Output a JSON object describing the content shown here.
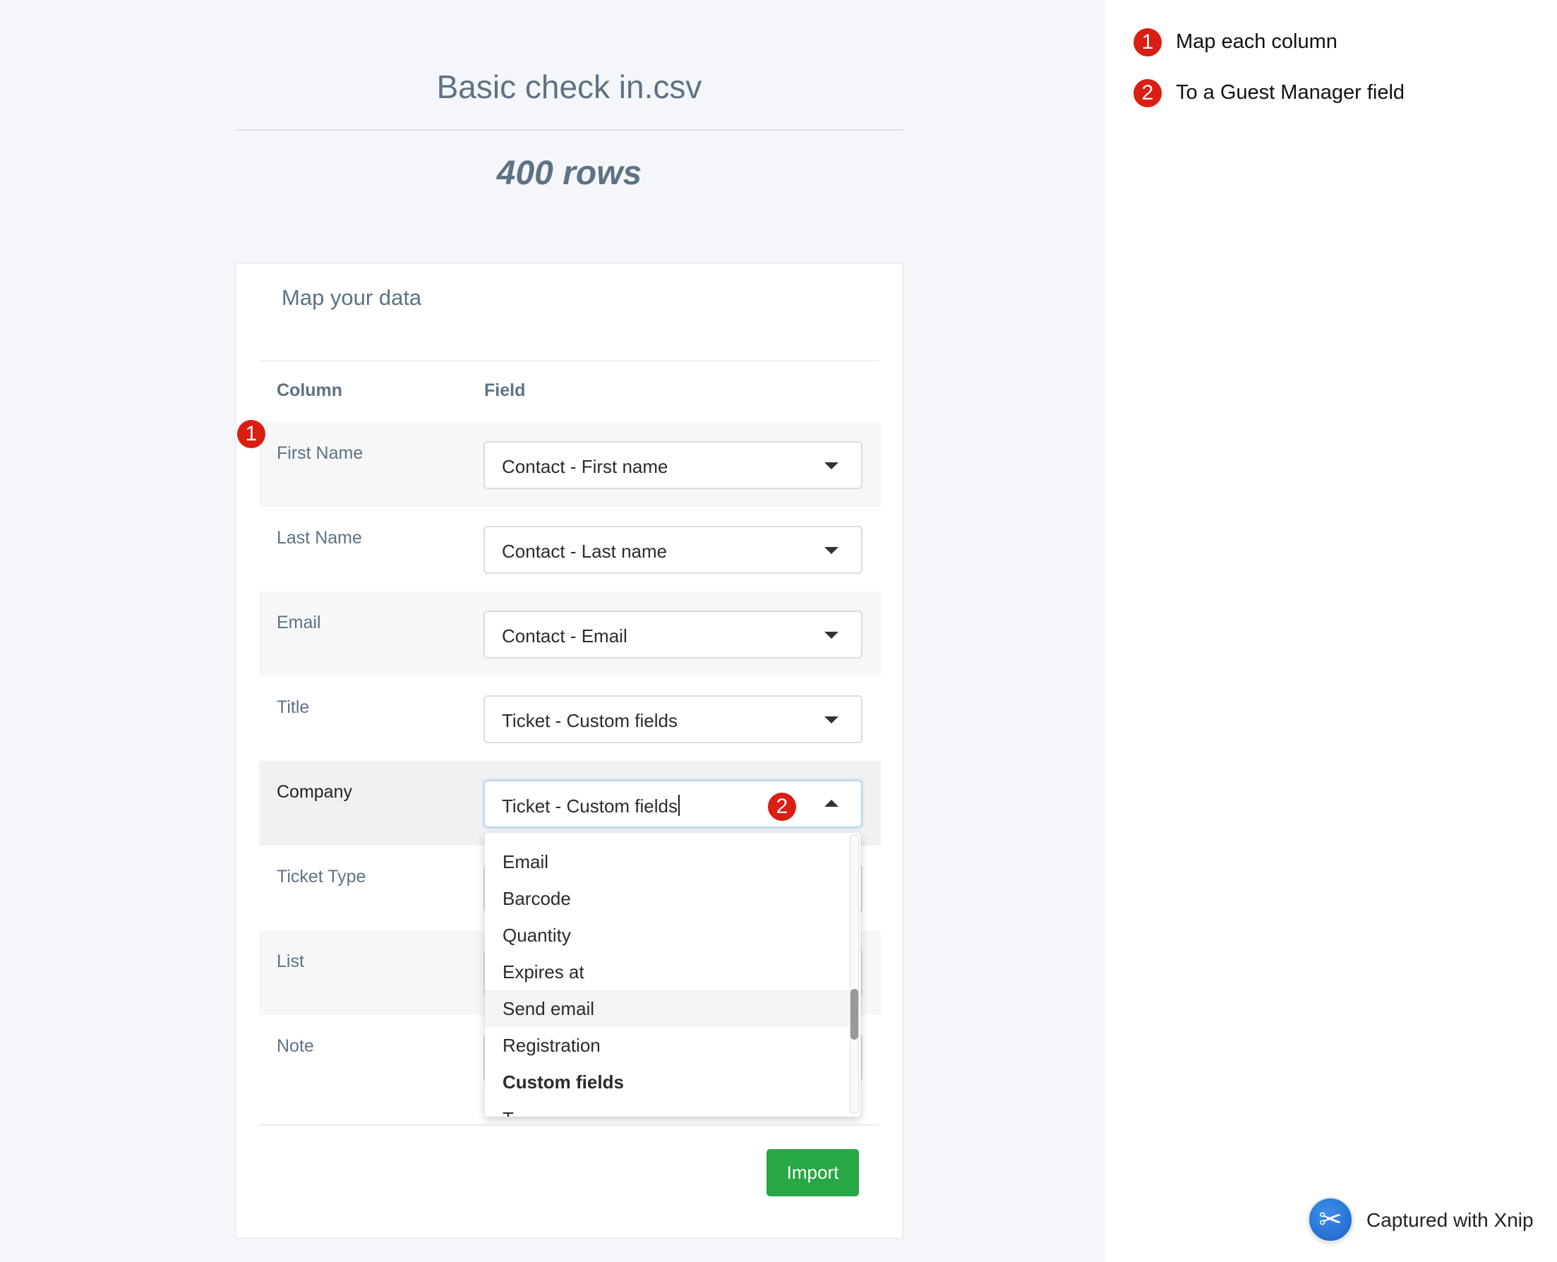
{
  "header": {
    "file_name": "Basic check in.csv",
    "row_count": "400 rows"
  },
  "card": {
    "title": "Map your data",
    "columns_header": "Column",
    "field_header": "Field",
    "rows": [
      {
        "column": "First Name",
        "field": "Contact - First name"
      },
      {
        "column": "Last Name",
        "field": "Contact - Last name"
      },
      {
        "column": "Email",
        "field": "Contact - Email"
      },
      {
        "column": "Title",
        "field": "Ticket - Custom fields"
      },
      {
        "column": "Company",
        "field": "Ticket - Custom fields"
      },
      {
        "column": "Ticket Type",
        "field": ""
      },
      {
        "column": "List",
        "field": ""
      },
      {
        "column": "Note",
        "field": ""
      }
    ],
    "import_label": "Import"
  },
  "dropdown": {
    "options": [
      "Email",
      "Barcode",
      "Quantity",
      "Expires at",
      "Send email",
      "Registration"
    ],
    "highlighted": "Send email",
    "group_label": "Custom fields",
    "partial_next": "T..."
  },
  "annotations": {
    "badge1": "1",
    "badge2": "2",
    "note1": "Map each column",
    "note2": "To a Guest Manager field"
  },
  "watermark": {
    "text": "Captured with Xnip",
    "icon": "scissors-icon"
  },
  "colors": {
    "accent_green": "#28a745",
    "badge_red": "#d91e12",
    "text_slate": "#5f7284"
  }
}
